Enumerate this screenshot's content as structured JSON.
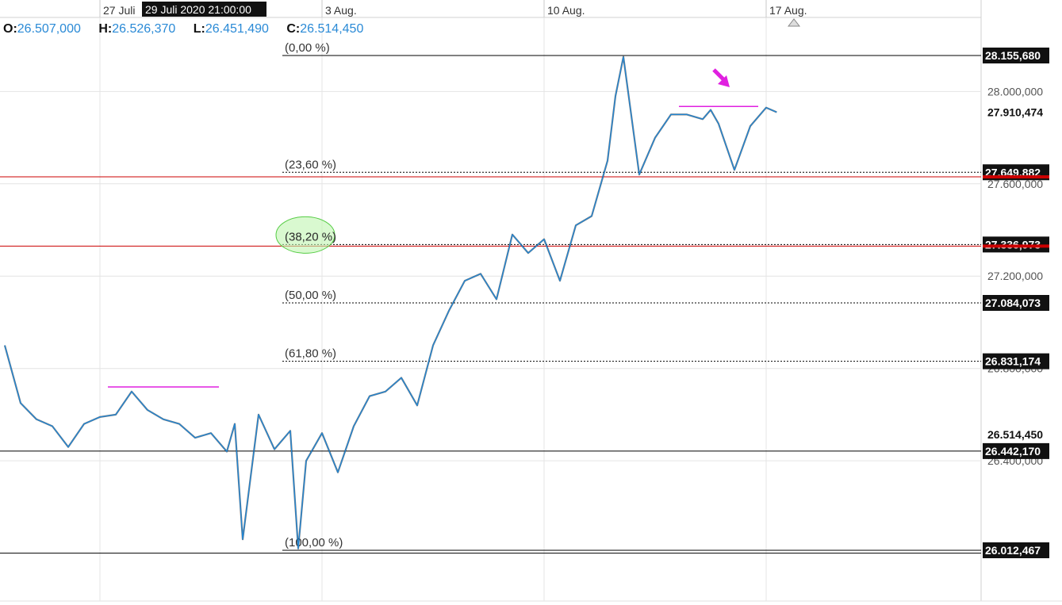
{
  "ohlc": {
    "o_label": "O:",
    "o_value": "26.507,000",
    "h_label": "H:",
    "h_value": "26.526,370",
    "l_label": "L:",
    "l_value": "26.451,490",
    "c_label": "C:",
    "c_value": "26.514,450"
  },
  "crosshair_time_label": "29 Juli 2020 21:00:00",
  "colors": {
    "price_line": "#1f86d6",
    "price_line_dark": "#111111",
    "fib_line": "#000000",
    "red_line": "#cc0000",
    "magenta": "#e020e0",
    "ellipse_fill": "#bff5b0",
    "ellipse_stroke": "#55cc44",
    "grid": "#e4e4e4",
    "tag_bg": "#111111",
    "tag_text": "#ffffff"
  },
  "chart_data": {
    "type": "line",
    "x_ticks": [
      {
        "label": "27 Juli",
        "date": "2020-07-27"
      },
      {
        "label": "3 Aug.",
        "date": "2020-08-03"
      },
      {
        "label": "10 Aug.",
        "date": "2020-08-10"
      },
      {
        "label": "17 Aug.",
        "date": "2020-08-17"
      }
    ],
    "y_axis_labels": [
      "28.000,000",
      "27.600,000",
      "27.200,000",
      "26.800,000",
      "26.400,000"
    ],
    "y_axis_label_values": [
      28000,
      27600,
      27200,
      26800,
      26400
    ],
    "ylim": [
      25800,
      28300
    ],
    "current_price": {
      "label": "27.910,474",
      "value": 27910.474
    },
    "crosshair_price": {
      "label": "26.514,450",
      "value": 26514.45
    },
    "fibonacci_levels": [
      {
        "label": "(0,00 %)",
        "value": 28155.68,
        "price_label": "28.155,680"
      },
      {
        "label": "(23,60 %)",
        "value": 27649.882,
        "price_label": "27.649,882"
      },
      {
        "label": "(38,20 %)",
        "value": 27336.973,
        "price_label": "27.336,973"
      },
      {
        "label": "(50,00 %)",
        "value": 27084.073,
        "price_label": "27.084,073"
      },
      {
        "label": "(61,80 %)",
        "value": 26831.174,
        "price_label": "26.831,174"
      },
      {
        "label": "(100,00 %)",
        "value": 26012.467,
        "price_label": "26.012,467"
      }
    ],
    "horizontal_lines": [
      {
        "value": 26442.17,
        "price_label": "26.442,170",
        "color": "black"
      },
      {
        "value": 27630,
        "color": "red"
      },
      {
        "value": 27330,
        "color": "red"
      },
      {
        "value": 26000,
        "color": "black"
      }
    ],
    "resistance_lines": [
      {
        "from": "2020-07-27",
        "to": "2020-07-30",
        "value": 26720
      },
      {
        "from": "2020-08-14",
        "to": "2020-08-16",
        "value": 27935
      }
    ],
    "series": [
      {
        "x": [
          "2020-07-24",
          "2020-07-24T12:00",
          "2020-07-25",
          "2020-07-25T12:00",
          "2020-07-26",
          "2020-07-26T12:00",
          "2020-07-27",
          "2020-07-27T12:00",
          "2020-07-28",
          "2020-07-28T12:00",
          "2020-07-29",
          "2020-07-29T12:00",
          "2020-07-30",
          "2020-07-30T12:00",
          "2020-07-31",
          "2020-07-31T06:00",
          "2020-07-31T12:00",
          "2020-08-01",
          "2020-08-01T12:00",
          "2020-08-02",
          "2020-08-02T06:00",
          "2020-08-02T12:00",
          "2020-08-03",
          "2020-08-03T12:00",
          "2020-08-04",
          "2020-08-04T12:00",
          "2020-08-05",
          "2020-08-05T12:00",
          "2020-08-06",
          "2020-08-06T12:00",
          "2020-08-07",
          "2020-08-07T12:00",
          "2020-08-08",
          "2020-08-08T12:00",
          "2020-08-09",
          "2020-08-09T12:00",
          "2020-08-10",
          "2020-08-10T12:00",
          "2020-08-11",
          "2020-08-11T12:00",
          "2020-08-12",
          "2020-08-12T06:00",
          "2020-08-12T12:00",
          "2020-08-13",
          "2020-08-13T12:00",
          "2020-08-14",
          "2020-08-14T12:00",
          "2020-08-15",
          "2020-08-15T06:00",
          "2020-08-15T12:00",
          "2020-08-16",
          "2020-08-16T12:00",
          "2020-08-17",
          "2020-08-17T08:00"
        ],
        "values": [
          26900,
          26650,
          26580,
          26550,
          26460,
          26560,
          26590,
          26600,
          26700,
          26620,
          26580,
          26560,
          26500,
          26520,
          26440,
          26560,
          26060,
          26600,
          26450,
          26530,
          26020,
          26400,
          26520,
          26350,
          26550,
          26680,
          26700,
          26760,
          26640,
          26900,
          27050,
          27180,
          27210,
          27100,
          27380,
          27300,
          27360,
          27180,
          27420,
          27460,
          27700,
          27980,
          28150,
          27640,
          27800,
          27900,
          27900,
          27880,
          27920,
          27860,
          27660,
          27850,
          27930,
          27910
        ]
      }
    ]
  }
}
